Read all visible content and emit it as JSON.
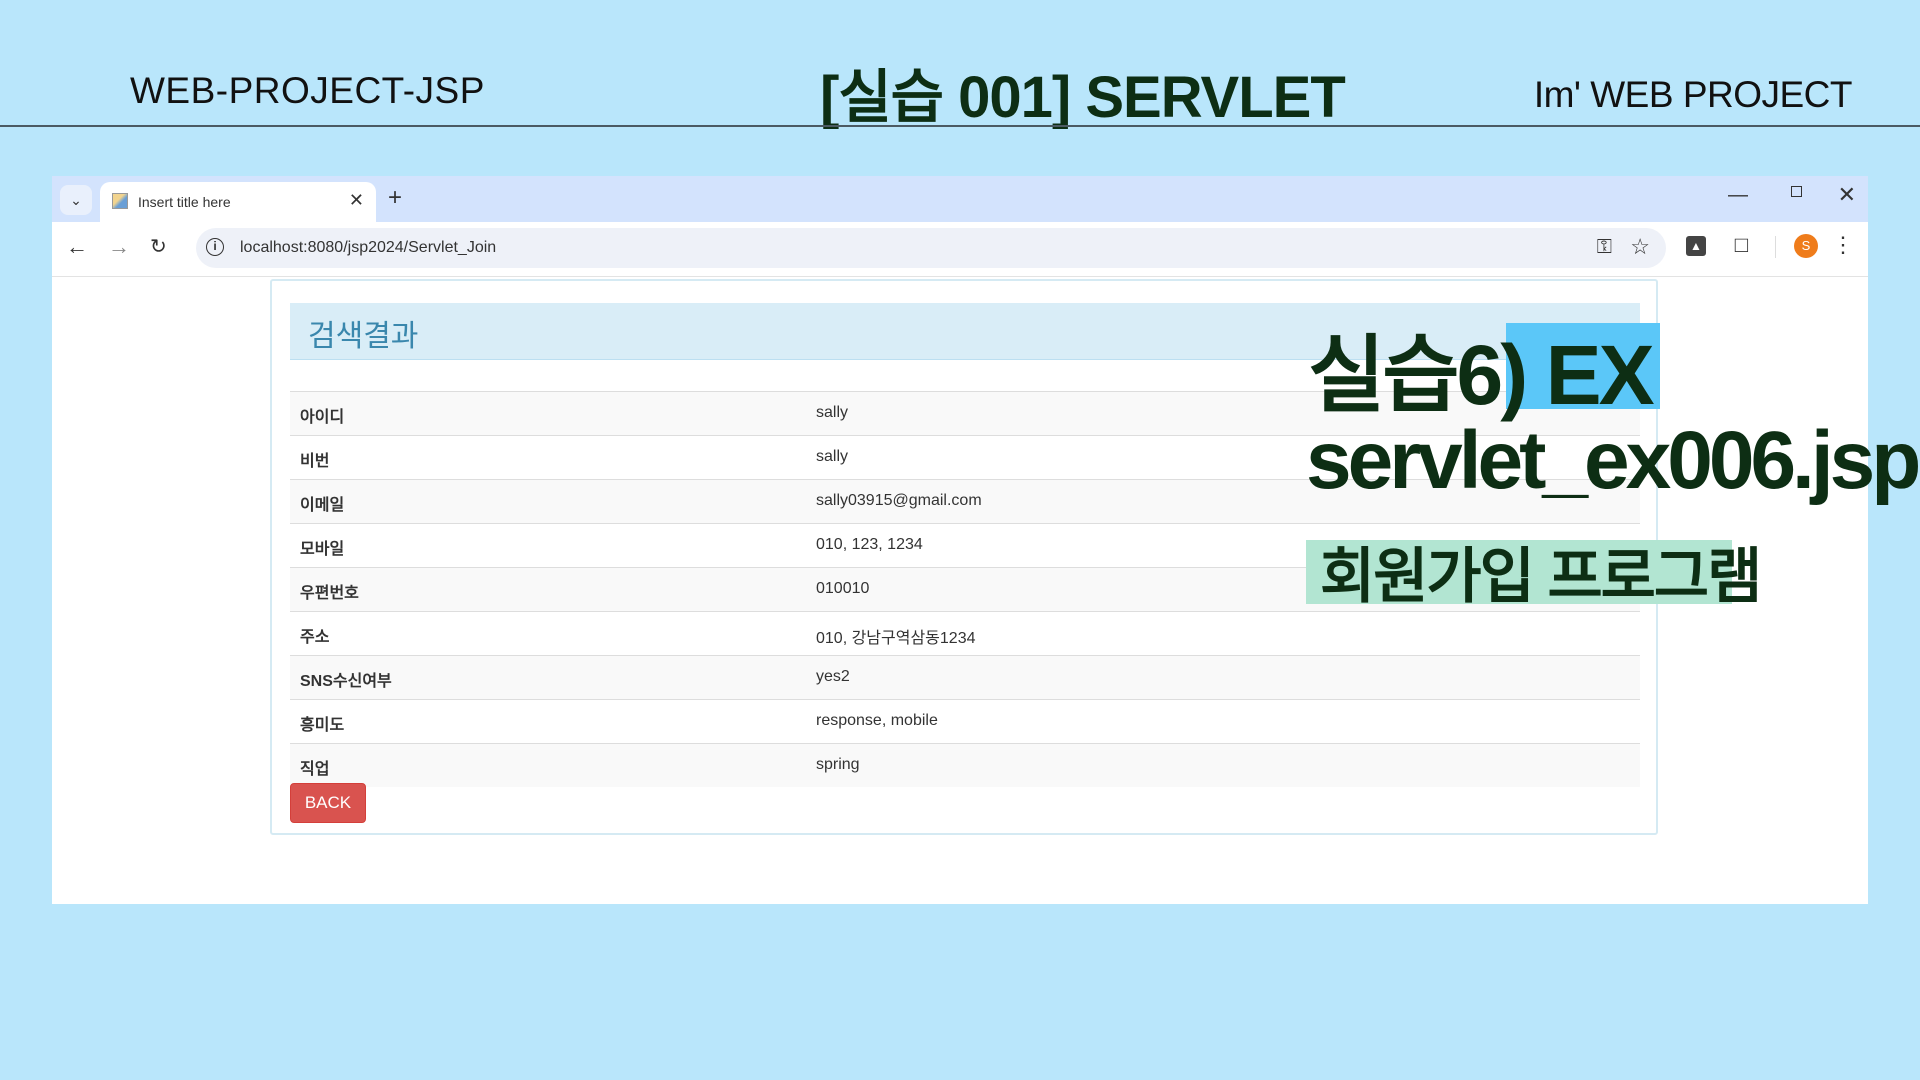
{
  "slide": {
    "top_left": "WEB-PROJECT-JSP",
    "title": "[실습 001]  SERVLET",
    "top_right": "Im'  WEB PROJECT"
  },
  "browser": {
    "tab_title": "Insert title here",
    "url": "localhost:8080/jsp2024/Servlet_Join",
    "profile_initial": "S"
  },
  "panel": {
    "title": "검색결과",
    "rows": [
      {
        "label": "아이디",
        "value": "sally"
      },
      {
        "label": "비번",
        "value": "sally"
      },
      {
        "label": "이메일",
        "value": "sally03915@gmail.com"
      },
      {
        "label": "모바일",
        "value": "010, 123, 1234"
      },
      {
        "label": "우편번호",
        "value": "010010"
      },
      {
        "label": "주소",
        "value": "010, 강남구역삼동1234"
      },
      {
        "label": "SNS수신여부",
        "value": "yes2"
      },
      {
        "label": "흥미도",
        "value": "response, mobile"
      },
      {
        "label": "직업",
        "value": "spring"
      }
    ],
    "back_label": "BACK"
  },
  "annotation": {
    "line1": "실습6) EX",
    "line2": "servlet_ex006.jsp",
    "line3": "회원가입 프로그램"
  },
  "colors": {
    "background": "#b9e6fb",
    "title_text": "#0d2e14",
    "highlight_blue": "#5bc7f8",
    "highlight_green": "#b2e5d2",
    "panel_heading_bg": "#d9edf7",
    "panel_heading_text": "#3a87ad",
    "back_button": "#d9534f"
  }
}
